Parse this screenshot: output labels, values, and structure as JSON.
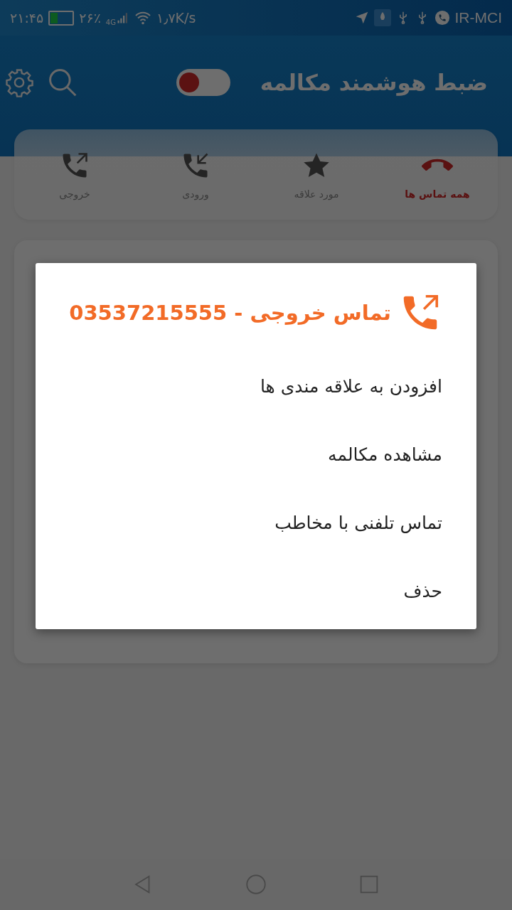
{
  "status_bar": {
    "time": "۲۱:۴۵",
    "battery": "۲۶٪",
    "network": "4G",
    "speed": "۱٫۷K/s",
    "carrier": "IR-MCI"
  },
  "header": {
    "title": "ضبط هوشمند مکالمه",
    "recording_on": false
  },
  "tabs": [
    {
      "label": "همه تماس ها",
      "kind": "all",
      "selected": true
    },
    {
      "label": "مورد علاقه",
      "kind": "favorite",
      "selected": false
    },
    {
      "label": "ورودی",
      "kind": "incoming",
      "selected": false
    },
    {
      "label": "خروجی",
      "kind": "outgoing",
      "selected": false
    }
  ],
  "dialog": {
    "title": "تماس خروجی - 03537215555",
    "items": [
      "افزودن به علاقه مندی ها",
      "مشاهده مکالمه",
      "تماس تلفنی با مخاطب",
      "حذف"
    ]
  }
}
